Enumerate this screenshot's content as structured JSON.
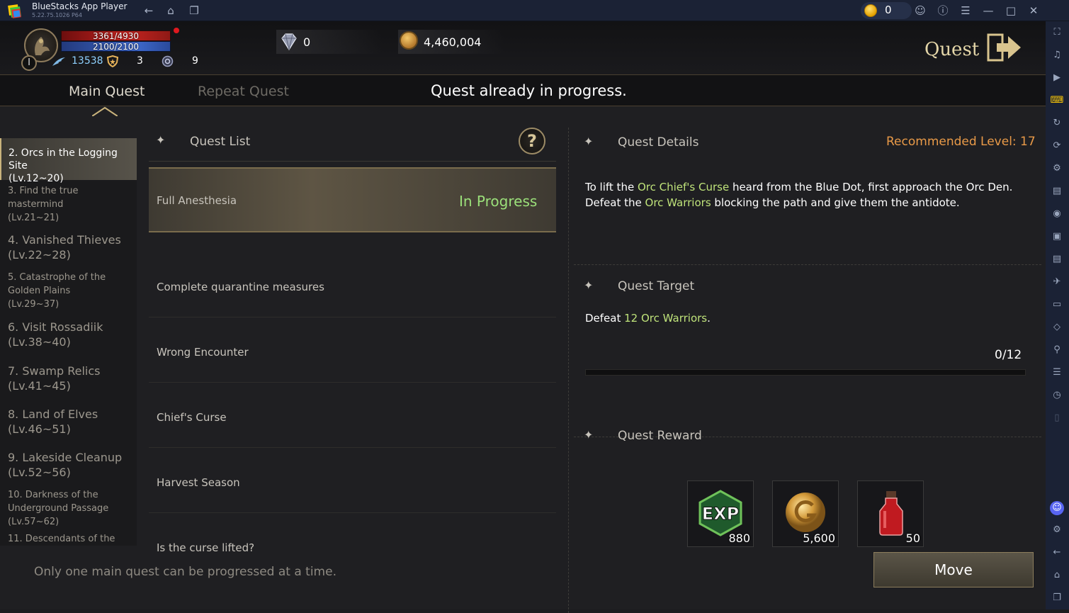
{
  "app": {
    "title": "BlueStacks App Player",
    "version": "5.22.75.1026 P64",
    "coins": "0"
  },
  "hud": {
    "hp": "3361/4930",
    "mp": "2100/2100",
    "level": "I",
    "power": "13538",
    "shields": "3",
    "tokens": "9",
    "gems": "0",
    "gold": "4,460,004",
    "screen_title": "Quest"
  },
  "tabs": {
    "main": "Main Quest",
    "repeat": "Repeat Quest"
  },
  "notice": "Quest already in progress.",
  "chapters": {
    "active": "2. Orcs in the Logging Site\n(Lv.12~20)",
    "items": [
      "3. Find the true mastermind\n(Lv.21~21)",
      "4. Vanished Thieves\n(Lv.22~28)",
      "5. Catastrophe of the Golden Plains\n(Lv.29~37)",
      "6. Visit Rossadiik\n(Lv.38~40)",
      "7. Swamp Relics\n(Lv.41~45)",
      "8. Land of Elves\n(Lv.46~51)",
      "9. Lakeside Cleanup\n(Lv.52~56)",
      "10. Darkness of the Underground Passage\n(Lv.57~62)",
      "11. Descendants of the"
    ]
  },
  "quest_list": {
    "title": "Quest List",
    "help": "?",
    "items": [
      {
        "name": "Full Anesthesia",
        "status": "In Progress"
      },
      {
        "name": "Complete quarantine measures"
      },
      {
        "name": "Wrong Encounter"
      },
      {
        "name": "Chief's Curse"
      },
      {
        "name": "Harvest Season"
      },
      {
        "name": "Is the curse lifted?"
      }
    ]
  },
  "details": {
    "title": "Quest Details",
    "recommended": "Recommended Level: 17",
    "desc": {
      "p1": "To lift the ",
      "h1": "Orc Chief's Curse",
      "p2": " heard from the Blue Dot, first approach the Orc Den. Defeat the ",
      "h2": "Orc Warriors",
      "p3": " blocking the path and give them the antidote."
    },
    "target_title": "Quest Target",
    "target": {
      "p1": "Defeat ",
      "h1": "12 Orc Warriors",
      "p2": "."
    },
    "progress_text": "0/12",
    "progress_fraction": 0,
    "reward_title": "Quest Reward",
    "rewards": [
      {
        "icon": "exp-icon",
        "label": "EXP",
        "value": "880"
      },
      {
        "icon": "gold-coin-icon",
        "value": "5,600"
      },
      {
        "icon": "red-potion-icon",
        "value": "50"
      }
    ]
  },
  "footer": {
    "message": "Only one main quest can be progressed at a time.",
    "move": "Move"
  }
}
